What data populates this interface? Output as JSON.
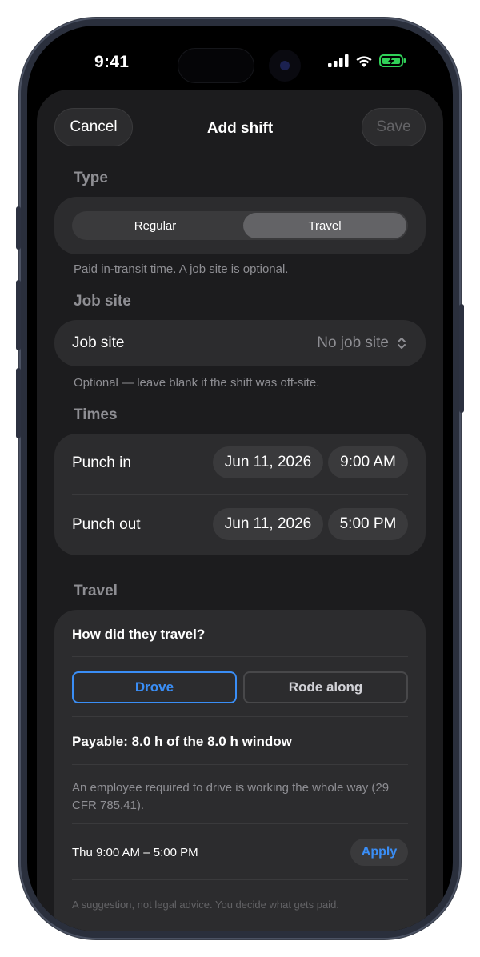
{
  "status_bar": {
    "time": "9:41"
  },
  "nav": {
    "cancel_label": "Cancel",
    "title": "Add shift",
    "save_label": "Save"
  },
  "type_section": {
    "heading": "Type",
    "options": [
      "Regular",
      "Travel"
    ],
    "selected": "Travel",
    "footnote": "Paid in-transit time. A job site is optional."
  },
  "job_site_section": {
    "heading": "Job site",
    "label": "Job site",
    "value": "No job site",
    "footnote": "Optional — leave blank if the shift was off-site."
  },
  "times_section": {
    "heading": "Times",
    "punch_in": {
      "label": "Punch in",
      "date": "Jun 11, 2026",
      "time": "9:00 AM"
    },
    "punch_out": {
      "label": "Punch out",
      "date": "Jun 11, 2026",
      "time": "5:00 PM"
    }
  },
  "travel_section": {
    "heading": "Travel",
    "question": "How did they travel?",
    "options": [
      "Drove",
      "Rode along"
    ],
    "selected": "Drove",
    "payable": "Payable: 8.0 h of the 8.0 h window",
    "explanation": "An employee required to drive is working the whole way (29 CFR 785.41).",
    "suggestion": "Thu 9:00 AM – 5:00 PM",
    "apply_label": "Apply",
    "disclaimer": "A suggestion, not legal advice. You decide what gets paid."
  },
  "colors": {
    "accent": "#3a8ef6",
    "background": "#1c1c1e",
    "card": "#2c2c2e",
    "secondary_text": "#8e8e93",
    "battery": "#30d158"
  }
}
